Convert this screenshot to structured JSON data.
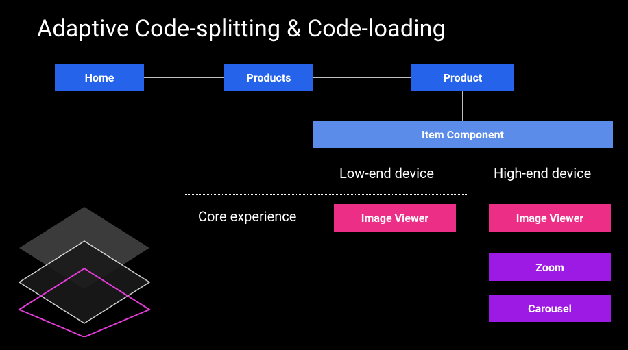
{
  "title": "Adaptive Code-splitting & Code-loading",
  "nav": {
    "home": "Home",
    "products": "Products",
    "product": "Product"
  },
  "item_component": "Item Component",
  "labels": {
    "low_end": "Low-end device",
    "high_end": "High-end device",
    "core_experience": "Core experience"
  },
  "modules": {
    "image_viewer": "Image Viewer",
    "zoom": "Zoom",
    "carousel": "Carousel"
  },
  "colors": {
    "blue": "#2563eb",
    "lightblue": "#5b8ce9",
    "pink": "#ec2e86",
    "purple": "#9d1ae5",
    "magenta_outline": "#e23bd6"
  }
}
